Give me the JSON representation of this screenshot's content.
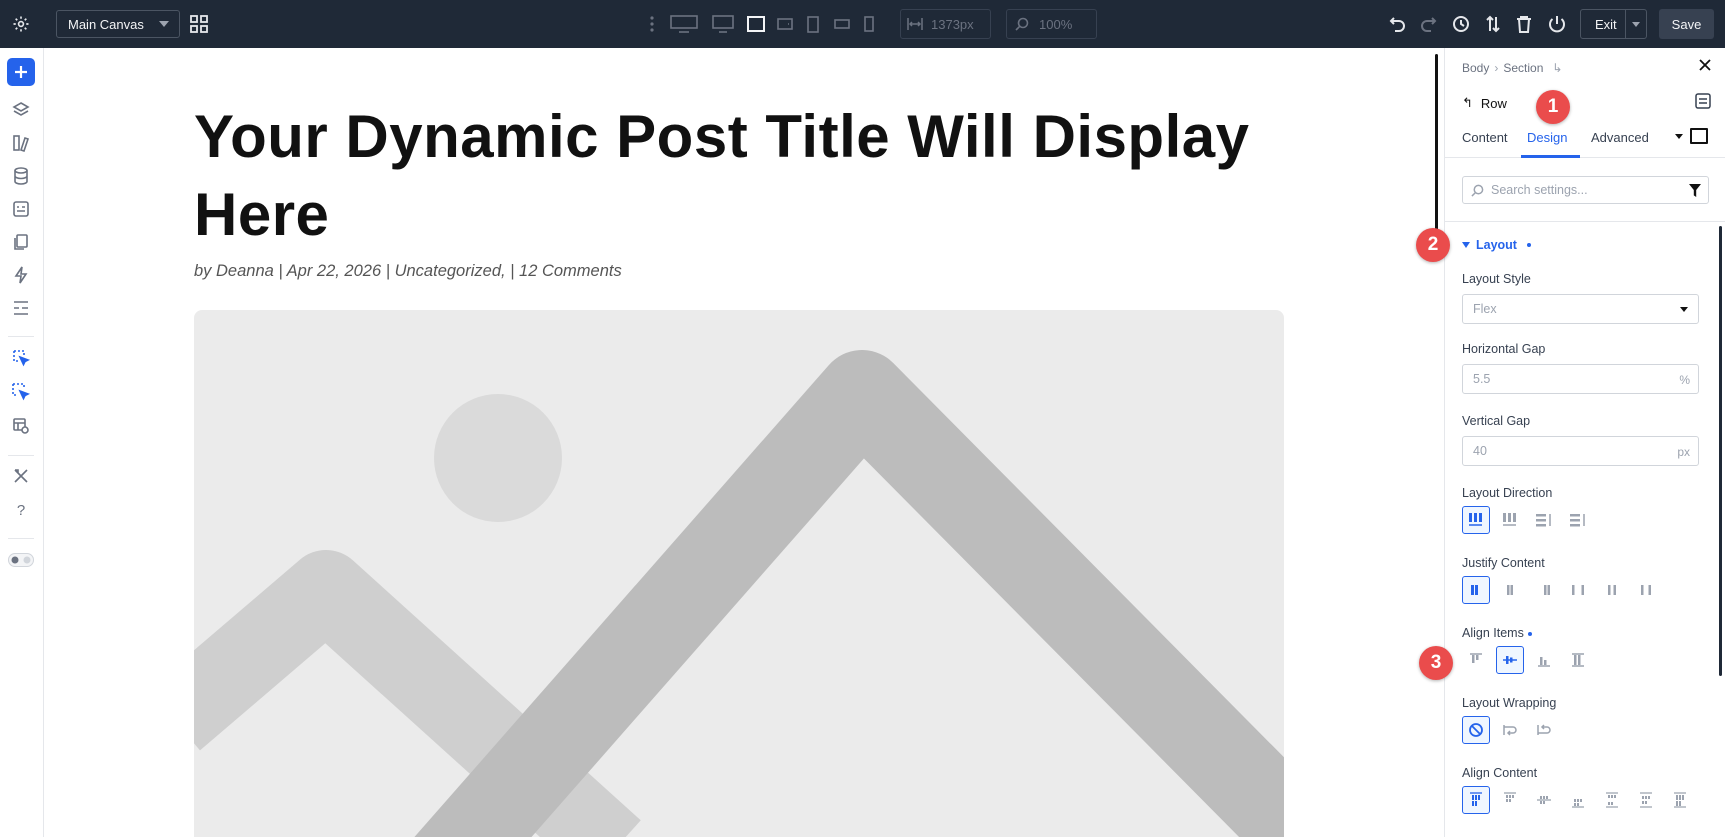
{
  "topbar": {
    "canvas_name": "Main Canvas",
    "width_value": "1373px",
    "zoom_value": "100%",
    "exit_label": "Exit",
    "save_label": "Save"
  },
  "canvas": {
    "post_title": "Your Dynamic Post Title Will Display Here",
    "post_meta": "by Deanna | Apr 22, 2026 | Uncategorized, | 12 Comments"
  },
  "panel": {
    "breadcrumb": [
      "Body",
      "Section"
    ],
    "element_title": "Row",
    "tabs": [
      {
        "label": "Content"
      },
      {
        "label": "Design",
        "active": true
      },
      {
        "label": "Advanced"
      }
    ],
    "search_placeholder": "Search settings...",
    "group_title": "Layout",
    "layout_style": {
      "label": "Layout Style",
      "value": "Flex"
    },
    "horizontal_gap": {
      "label": "Horizontal Gap",
      "value": "5.5",
      "unit": "%"
    },
    "vertical_gap": {
      "label": "Vertical Gap",
      "value": "40",
      "unit": "px"
    },
    "layout_direction": {
      "label": "Layout Direction",
      "selected": 0
    },
    "justify_content": {
      "label": "Justify Content",
      "selected": 0
    },
    "align_items": {
      "label": "Align Items",
      "selected": 1
    },
    "layout_wrapping": {
      "label": "Layout Wrapping",
      "selected": 0
    },
    "align_content": {
      "label": "Align Content",
      "selected": 0
    }
  },
  "badges": [
    "1",
    "2",
    "3"
  ],
  "colors": {
    "topbar_bg": "#1f2937",
    "accent": "#2563eb",
    "badge": "#ea4c4c"
  }
}
